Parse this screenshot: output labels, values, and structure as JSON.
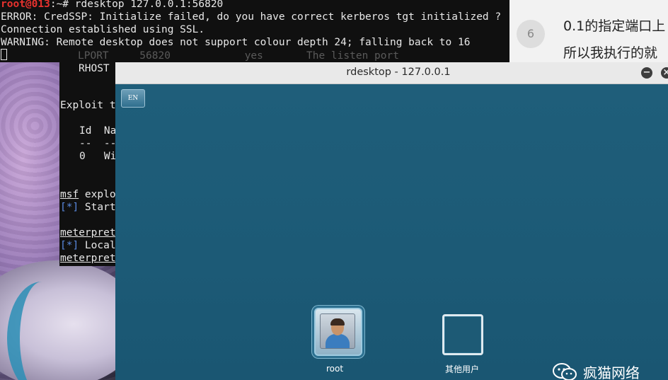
{
  "terminal": {
    "prompt_user": "root@013",
    "prompt_rest": ":~# rdesktop 127.0.0.1:56820",
    "line2": "ERROR: CredSSP: Initialize failed, do you have correct kerberos tgt initialized ?",
    "line3": "Connection established using SSL.",
    "line4": "WARNING: Remote desktop does not support colour depth 24; falling back to 16",
    "bg_lport": "LPORT     56820            yes       The listen port",
    "bg_rhost": "RHOST"
  },
  "msf": {
    "l1": "Exploit t",
    "l2": "Id  Na",
    "l3": "--  --",
    "l4": "0   Wi",
    "l5": "msf",
    "l5b": " explo",
    "l6a": "[*]",
    "l6b": " Start",
    "l7": "meterpret",
    "l8a": "[*]",
    "l8b": " Local",
    "l9": "meterpret"
  },
  "article": {
    "line1": "0.1的指定端口上",
    "line2": "所以我执行的就",
    "num": "6"
  },
  "window": {
    "title": "rdesktop - 127.0.0.1",
    "minimize_glyph": "−",
    "close_glyph": "×",
    "lang_indicator": "EN"
  },
  "login": {
    "user1": "root",
    "user2": "其他用户"
  },
  "watermark": "疯猫网络",
  "colors": {
    "desktop_bg": "#1d5a75",
    "prompt_red": "#e8322e",
    "info_blue": "#5a8ae0"
  }
}
